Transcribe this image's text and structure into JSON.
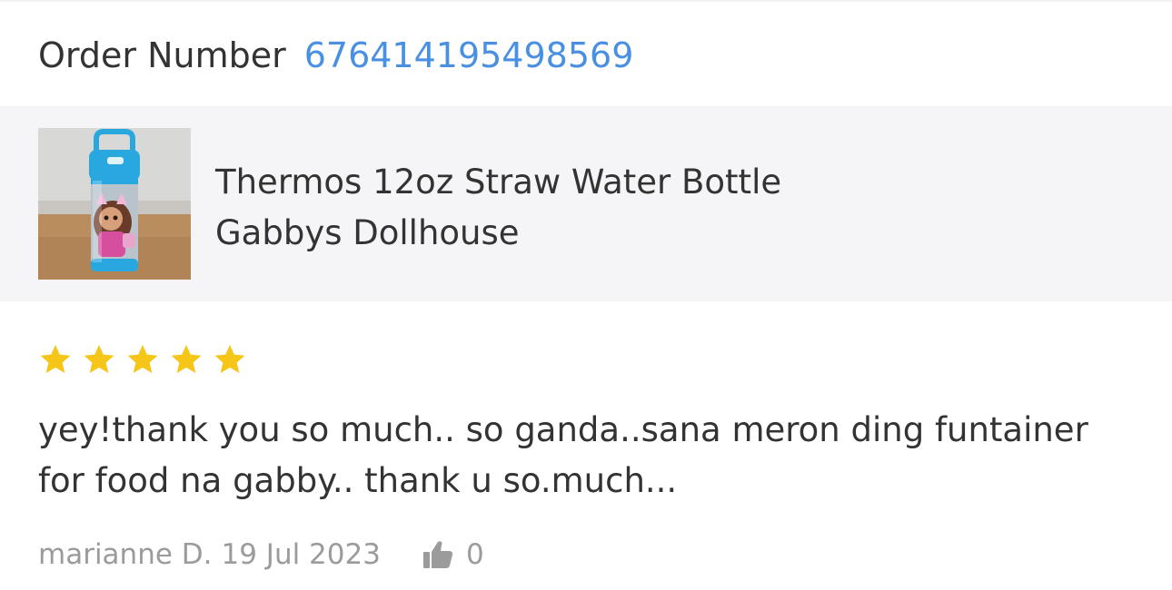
{
  "order": {
    "label": "Order Number",
    "number": "676414195498569",
    "number_color": "#4a90e2"
  },
  "product": {
    "image_icon": "product-thumbnail",
    "title_line1": "Thermos 12oz Straw Water Bottle",
    "title_line2": "Gabbys Dollhouse"
  },
  "review": {
    "rating": 5,
    "rating_max": 5,
    "star_color": "#f5c518",
    "text_line1": "yey!thank you so much.. so ganda..sana meron ding funtainer",
    "text_line2": "for food na gabby.. thank u so.much...",
    "author": "marianne D.",
    "date": "19 Jul 2023",
    "like_icon": "thumbs-up-icon",
    "like_count": "0"
  }
}
